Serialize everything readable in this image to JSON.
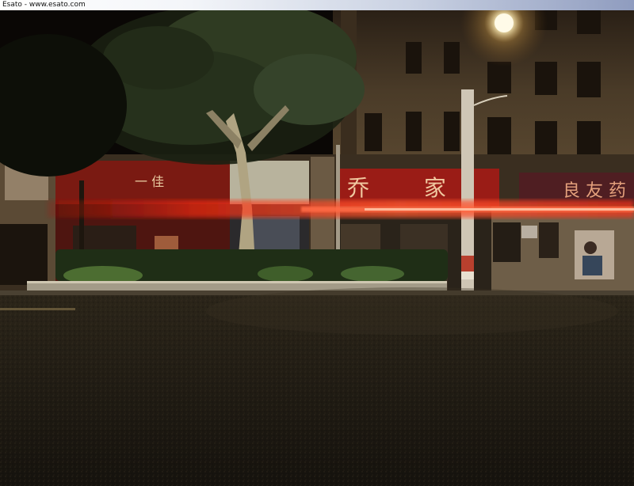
{
  "header": {
    "caption": "Esato - www.esato.com"
  },
  "scene": {
    "signs": {
      "middle_store": "乔 家",
      "right_store": "良 友 药",
      "left_store": "一 佳"
    },
    "colors": {
      "sky": "#070503",
      "road": "#1f1b14",
      "building": "#52412c",
      "light_trail": "#ff2a10",
      "street_lamp": "#fff3c8",
      "tree": "#2f3b22"
    }
  }
}
